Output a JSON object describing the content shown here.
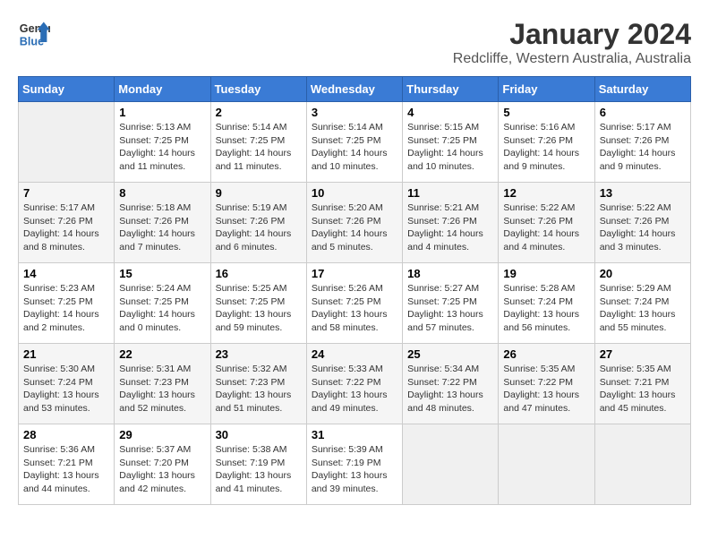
{
  "header": {
    "logo_line1": "General",
    "logo_line2": "Blue",
    "month": "January 2024",
    "location": "Redcliffe, Western Australia, Australia"
  },
  "weekdays": [
    "Sunday",
    "Monday",
    "Tuesday",
    "Wednesday",
    "Thursday",
    "Friday",
    "Saturday"
  ],
  "weeks": [
    [
      {
        "day": "",
        "info": ""
      },
      {
        "day": "1",
        "info": "Sunrise: 5:13 AM\nSunset: 7:25 PM\nDaylight: 14 hours\nand 11 minutes."
      },
      {
        "day": "2",
        "info": "Sunrise: 5:14 AM\nSunset: 7:25 PM\nDaylight: 14 hours\nand 11 minutes."
      },
      {
        "day": "3",
        "info": "Sunrise: 5:14 AM\nSunset: 7:25 PM\nDaylight: 14 hours\nand 10 minutes."
      },
      {
        "day": "4",
        "info": "Sunrise: 5:15 AM\nSunset: 7:25 PM\nDaylight: 14 hours\nand 10 minutes."
      },
      {
        "day": "5",
        "info": "Sunrise: 5:16 AM\nSunset: 7:26 PM\nDaylight: 14 hours\nand 9 minutes."
      },
      {
        "day": "6",
        "info": "Sunrise: 5:17 AM\nSunset: 7:26 PM\nDaylight: 14 hours\nand 9 minutes."
      }
    ],
    [
      {
        "day": "7",
        "info": "Sunrise: 5:17 AM\nSunset: 7:26 PM\nDaylight: 14 hours\nand 8 minutes."
      },
      {
        "day": "8",
        "info": "Sunrise: 5:18 AM\nSunset: 7:26 PM\nDaylight: 14 hours\nand 7 minutes."
      },
      {
        "day": "9",
        "info": "Sunrise: 5:19 AM\nSunset: 7:26 PM\nDaylight: 14 hours\nand 6 minutes."
      },
      {
        "day": "10",
        "info": "Sunrise: 5:20 AM\nSunset: 7:26 PM\nDaylight: 14 hours\nand 5 minutes."
      },
      {
        "day": "11",
        "info": "Sunrise: 5:21 AM\nSunset: 7:26 PM\nDaylight: 14 hours\nand 4 minutes."
      },
      {
        "day": "12",
        "info": "Sunrise: 5:22 AM\nSunset: 7:26 PM\nDaylight: 14 hours\nand 4 minutes."
      },
      {
        "day": "13",
        "info": "Sunrise: 5:22 AM\nSunset: 7:26 PM\nDaylight: 14 hours\nand 3 minutes."
      }
    ],
    [
      {
        "day": "14",
        "info": "Sunrise: 5:23 AM\nSunset: 7:25 PM\nDaylight: 14 hours\nand 2 minutes."
      },
      {
        "day": "15",
        "info": "Sunrise: 5:24 AM\nSunset: 7:25 PM\nDaylight: 14 hours\nand 0 minutes."
      },
      {
        "day": "16",
        "info": "Sunrise: 5:25 AM\nSunset: 7:25 PM\nDaylight: 13 hours\nand 59 minutes."
      },
      {
        "day": "17",
        "info": "Sunrise: 5:26 AM\nSunset: 7:25 PM\nDaylight: 13 hours\nand 58 minutes."
      },
      {
        "day": "18",
        "info": "Sunrise: 5:27 AM\nSunset: 7:25 PM\nDaylight: 13 hours\nand 57 minutes."
      },
      {
        "day": "19",
        "info": "Sunrise: 5:28 AM\nSunset: 7:24 PM\nDaylight: 13 hours\nand 56 minutes."
      },
      {
        "day": "20",
        "info": "Sunrise: 5:29 AM\nSunset: 7:24 PM\nDaylight: 13 hours\nand 55 minutes."
      }
    ],
    [
      {
        "day": "21",
        "info": "Sunrise: 5:30 AM\nSunset: 7:24 PM\nDaylight: 13 hours\nand 53 minutes."
      },
      {
        "day": "22",
        "info": "Sunrise: 5:31 AM\nSunset: 7:23 PM\nDaylight: 13 hours\nand 52 minutes."
      },
      {
        "day": "23",
        "info": "Sunrise: 5:32 AM\nSunset: 7:23 PM\nDaylight: 13 hours\nand 51 minutes."
      },
      {
        "day": "24",
        "info": "Sunrise: 5:33 AM\nSunset: 7:22 PM\nDaylight: 13 hours\nand 49 minutes."
      },
      {
        "day": "25",
        "info": "Sunrise: 5:34 AM\nSunset: 7:22 PM\nDaylight: 13 hours\nand 48 minutes."
      },
      {
        "day": "26",
        "info": "Sunrise: 5:35 AM\nSunset: 7:22 PM\nDaylight: 13 hours\nand 47 minutes."
      },
      {
        "day": "27",
        "info": "Sunrise: 5:35 AM\nSunset: 7:21 PM\nDaylight: 13 hours\nand 45 minutes."
      }
    ],
    [
      {
        "day": "28",
        "info": "Sunrise: 5:36 AM\nSunset: 7:21 PM\nDaylight: 13 hours\nand 44 minutes."
      },
      {
        "day": "29",
        "info": "Sunrise: 5:37 AM\nSunset: 7:20 PM\nDaylight: 13 hours\nand 42 minutes."
      },
      {
        "day": "30",
        "info": "Sunrise: 5:38 AM\nSunset: 7:19 PM\nDaylight: 13 hours\nand 41 minutes."
      },
      {
        "day": "31",
        "info": "Sunrise: 5:39 AM\nSunset: 7:19 PM\nDaylight: 13 hours\nand 39 minutes."
      },
      {
        "day": "",
        "info": ""
      },
      {
        "day": "",
        "info": ""
      },
      {
        "day": "",
        "info": ""
      }
    ]
  ]
}
